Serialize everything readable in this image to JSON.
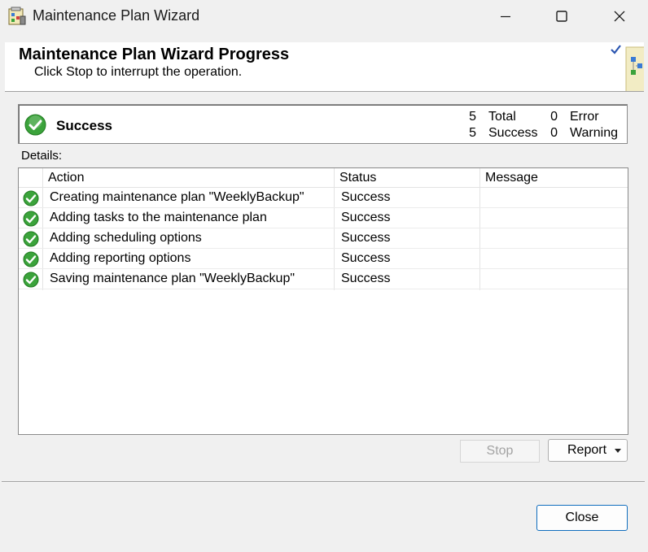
{
  "window": {
    "title": "Maintenance Plan Wizard"
  },
  "header": {
    "title": "Maintenance Plan Wizard Progress",
    "subtitle": "Click Stop to interrupt the operation."
  },
  "summary": {
    "status": "Success",
    "total_count": "5",
    "total_label": "Total",
    "success_count": "5",
    "success_label": "Success",
    "error_count": "0",
    "error_label": "Error",
    "warning_count": "0",
    "warning_label": "Warning"
  },
  "details": {
    "label": "Details:",
    "columns": [
      "Action",
      "Status",
      "Message"
    ],
    "rows": [
      {
        "action": "Creating maintenance plan \"WeeklyBackup\"",
        "status": "Success",
        "message": ""
      },
      {
        "action": "Adding tasks to the maintenance plan",
        "status": "Success",
        "message": ""
      },
      {
        "action": "Adding scheduling options",
        "status": "Success",
        "message": ""
      },
      {
        "action": "Adding reporting options",
        "status": "Success",
        "message": ""
      },
      {
        "action": "Saving maintenance plan \"WeeklyBackup\"",
        "status": "Success",
        "message": ""
      }
    ]
  },
  "buttons": {
    "stop": "Stop",
    "report": "Report",
    "close": "Close"
  },
  "icons": {
    "status": "success-check-icon",
    "app": "maintenance-wizard-icon"
  },
  "colors": {
    "success": "#3ba33b",
    "accent": "#0f6cbd"
  }
}
